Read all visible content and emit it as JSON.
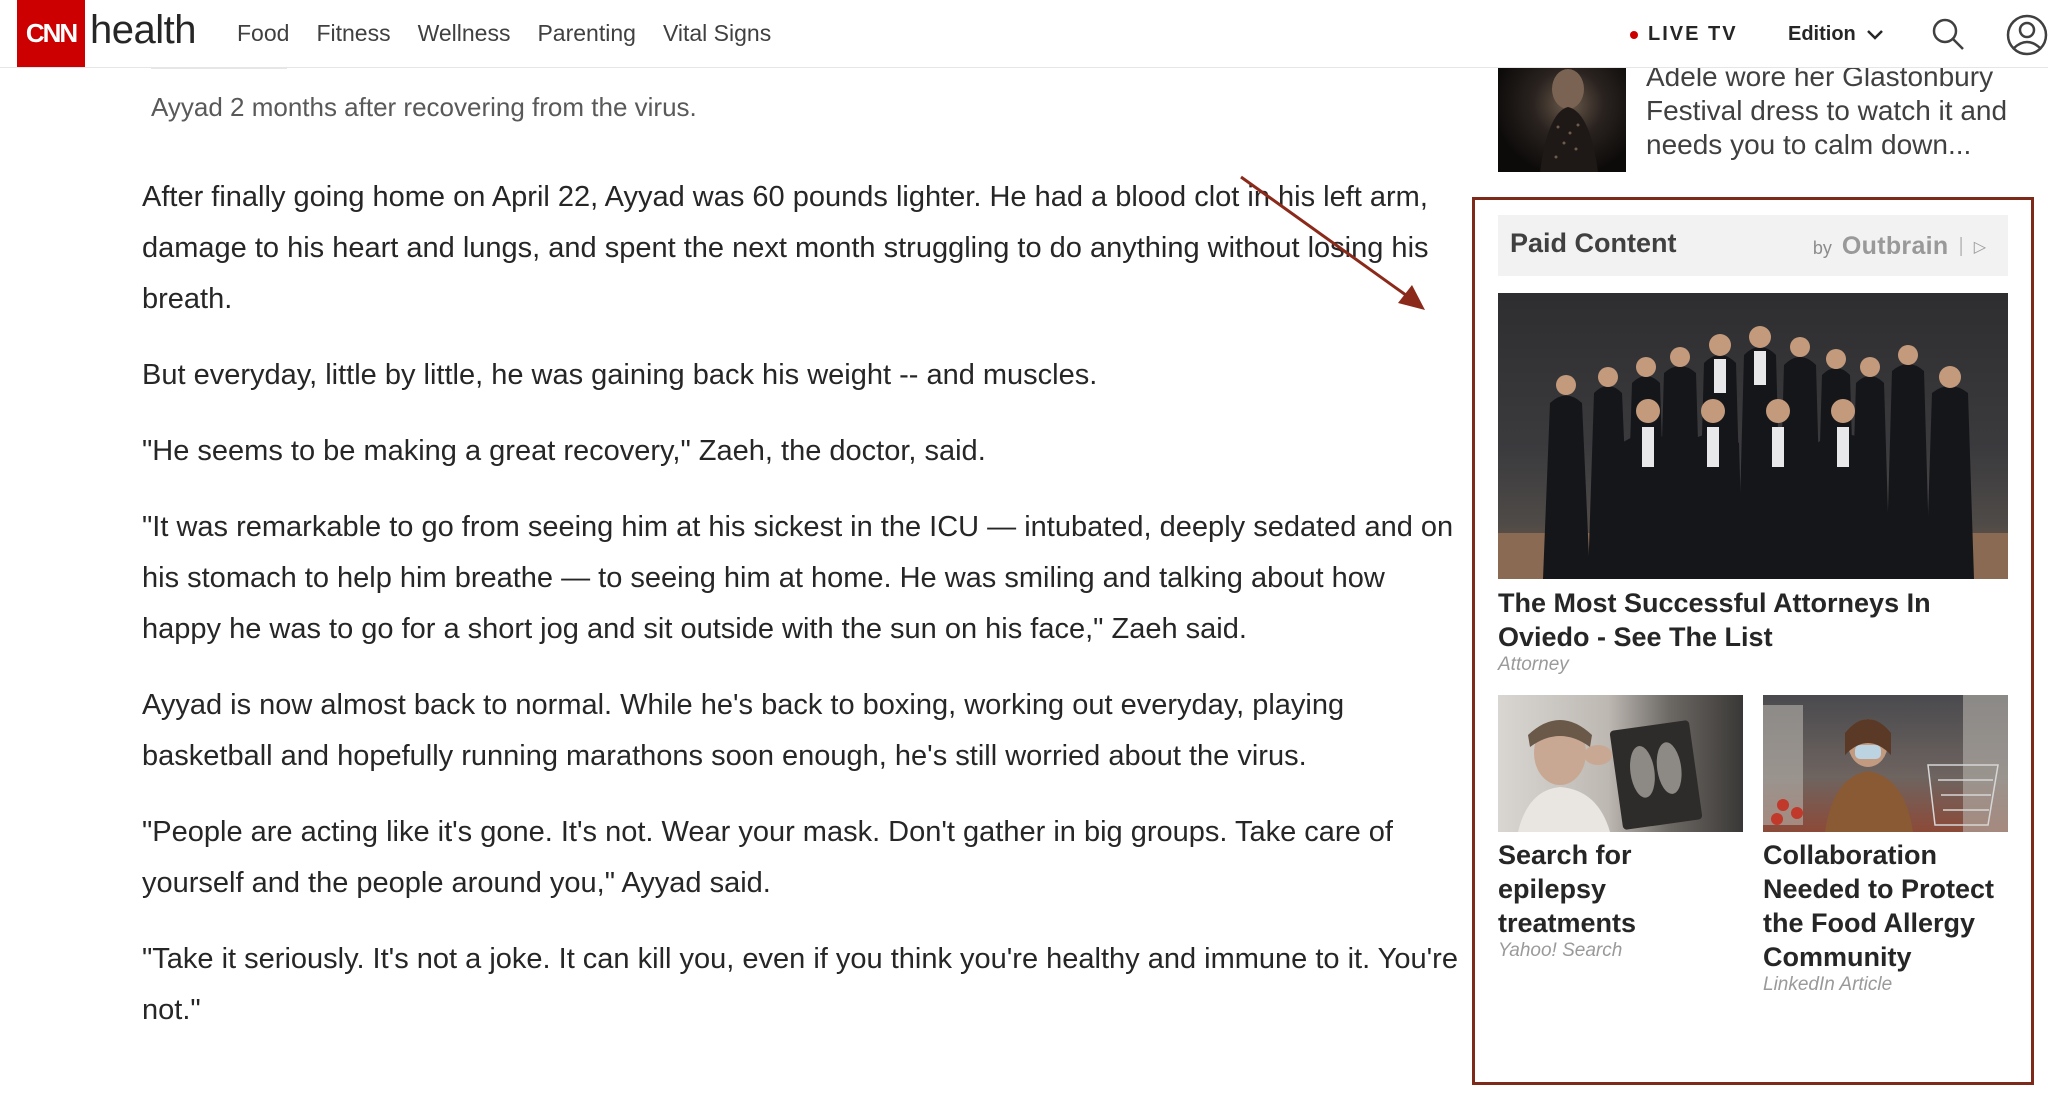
{
  "header": {
    "logo_brand": "CNN",
    "logo_section": "health",
    "nav": [
      "Food",
      "Fitness",
      "Wellness",
      "Parenting",
      "Vital Signs"
    ],
    "live_tv": "LIVE TV",
    "edition": "Edition",
    "icons": {
      "search": "search-icon",
      "account": "account-icon",
      "edition": "chevron-down-icon"
    }
  },
  "article": {
    "caption": "Ayyad 2 months after recovering from the virus.",
    "paragraphs": [
      "After finally going home on April 22, Ayyad was 60 pounds lighter. He had a blood clot in his left arm, damage to his heart and lungs, and spent the next month struggling to do anything without losing his breath.",
      "But everyday, little by little, he was gaining back his weight -- and muscles.",
      "\"He seems to be making a great recovery,\" Zaeh, the doctor, said.",
      "\"It was remarkable to go from seeing him at his sickest in the ICU — intubated, deeply sedated and on his stomach to help him breathe — to seeing him at home. He was smiling and talking about how happy he was to go for a short jog and sit outside with the sun on his face,\" Zaeh said.",
      "Ayyad is now almost back to normal. While he's back to boxing, working out everyday, playing basketball and hopefully running marathons soon enough, he's still worried about the virus.",
      "\"People are acting like it's gone. It's not. Wear your mask. Don't gather in big groups. Take care of yourself and the people around you,\" Ayyad said.",
      "\"Take it seriously. It's not a joke. It can kill you, even if you think you're healthy and immune to it. You're not.\""
    ]
  },
  "sidebar": {
    "teaser": "Adele wore her Glastonbury Festival dress to watch it and needs you to calm down...",
    "paid": {
      "title": "Paid Content",
      "by": "by",
      "brand": "Outbrain",
      "items": [
        {
          "title": "The Most Successful Attorneys In Oviedo - See The List",
          "source": "Attorney"
        },
        {
          "title": "Search for epilepsy treatments",
          "source": "Yahoo! Search"
        },
        {
          "title": "Collaboration Needed to Protect the Food Allergy Community",
          "source": "LinkedIn Article"
        }
      ]
    }
  },
  "colors": {
    "brand_red": "#cc0000",
    "highlight_border": "#7d2a1a",
    "annotation_arrow": "#8b2a1a"
  }
}
